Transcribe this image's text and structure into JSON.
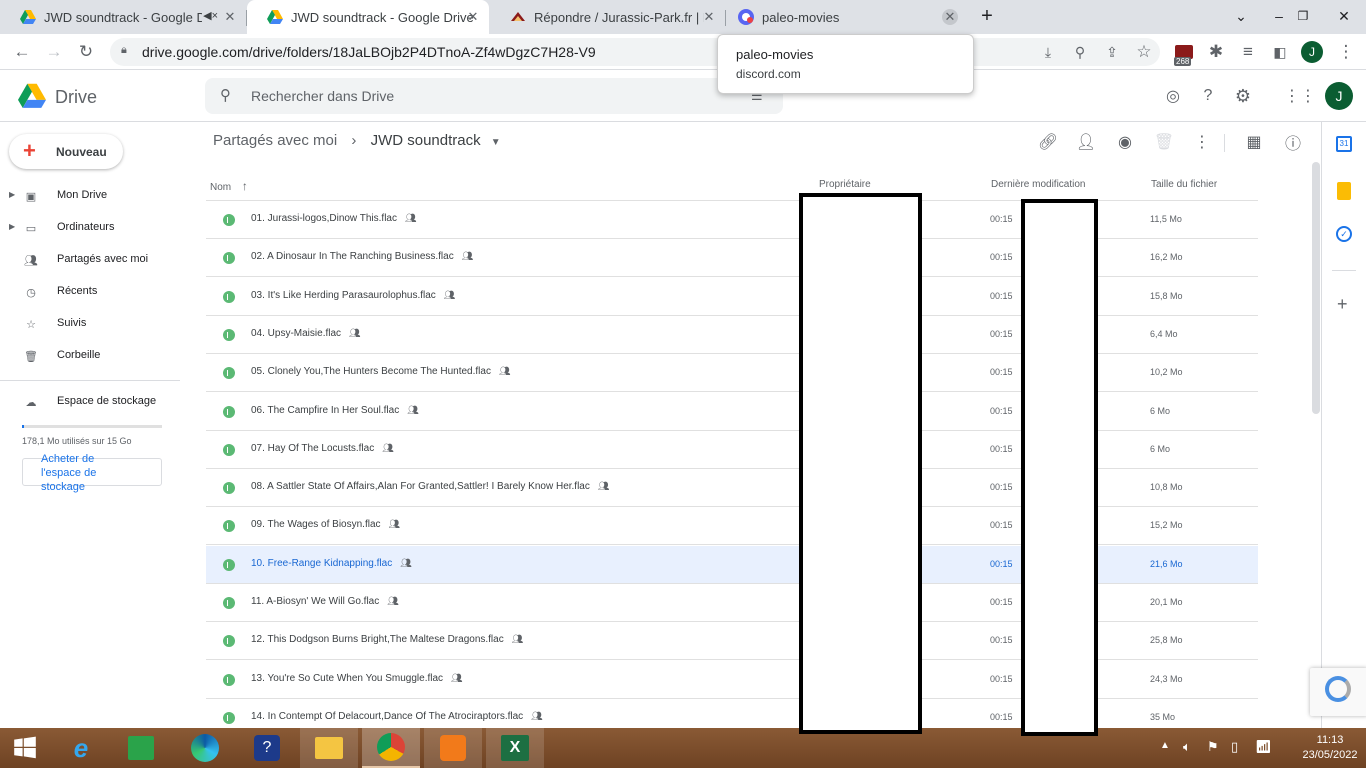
{
  "browser": {
    "tabs": [
      {
        "title": "JWD soundtrack - Google Drive",
        "active": false
      },
      {
        "title": "JWD soundtrack - Google Drive",
        "active": true
      },
      {
        "title": "Répondre / Jurassic-Park.fr | Le Forum",
        "active": false
      },
      {
        "title": "paleo-movies",
        "active": false
      }
    ],
    "url": "drive.google.com/drive/folders/18JaLBOjb2P4DTnoA-Zf4wDgzC7H28-V9",
    "badge": "268",
    "profile_letter": "J",
    "hover_card": {
      "title": "paleo-movies",
      "domain": "discord.com"
    }
  },
  "drive": {
    "app_name": "Drive",
    "search_placeholder": "Rechercher dans Drive",
    "avatar_letter": "J",
    "new_button": "Nouveau",
    "nav": [
      {
        "label": "Mon Drive",
        "icon": "my-drive-icon",
        "expandable": true
      },
      {
        "label": "Ordinateurs",
        "icon": "computer-icon",
        "expandable": true
      },
      {
        "label": "Partagés avec moi",
        "icon": "shared-icon",
        "expandable": false
      },
      {
        "label": "Récents",
        "icon": "clock-icon",
        "expandable": false
      },
      {
        "label": "Suivis",
        "icon": "star-icon",
        "expandable": false
      },
      {
        "label": "Corbeille",
        "icon": "trash-icon",
        "expandable": false
      }
    ],
    "storage": {
      "label": "Espace de stockage",
      "usage": "178,1 Mo utilisés sur 15 Go",
      "fraction_used": 0.012,
      "buy_button": "Acheter de l'espace de stockage"
    },
    "breadcrumb": {
      "parent": "Partagés avec moi",
      "current": "JWD soundtrack"
    },
    "columns": {
      "name": "Nom",
      "owner": "Propriétaire",
      "modified": "Dernière modification",
      "size": "Taille du fichier"
    },
    "files": [
      {
        "name": "01. Jurassi-logos,Dinow This.flac",
        "modified": "00:15",
        "size": "11,5 Mo"
      },
      {
        "name": "02. A Dinosaur In The Ranching Business.flac",
        "modified": "00:15",
        "size": "16,2 Mo"
      },
      {
        "name": "03. It's Like Herding Parasaurolophus.flac",
        "modified": "00:15",
        "size": "15,8 Mo"
      },
      {
        "name": "04. Upsy-Maisie.flac",
        "modified": "00:15",
        "size": "6,4 Mo"
      },
      {
        "name": "05. Clonely You,The Hunters Become The Hunted.flac",
        "modified": "00:15",
        "size": "10,2 Mo"
      },
      {
        "name": "06. The Campfire In Her Soul.flac",
        "modified": "00:15",
        "size": "6 Mo"
      },
      {
        "name": "07. Hay Of The Locusts.flac",
        "modified": "00:15",
        "size": "6 Mo"
      },
      {
        "name": "08. A Sattler State Of Affairs,Alan For Granted,Sattler! I Barely Know Her.flac",
        "modified": "00:15",
        "size": "10,8 Mo"
      },
      {
        "name": "09. The Wages of Biosyn.flac",
        "modified": "00:15",
        "size": "15,2 Mo"
      },
      {
        "name": "10. Free-Range Kidnapping.flac",
        "modified": "00:15",
        "size": "21,6 Mo",
        "selected": true
      },
      {
        "name": "11. A-Biosyn' We Will Go.flac",
        "modified": "00:15",
        "size": "20,1 Mo"
      },
      {
        "name": "12. This Dodgson Burns Bright,The Maltese Dragons.flac",
        "modified": "00:15",
        "size": "25,8 Mo"
      },
      {
        "name": "13. You're So Cute When You Smuggle.flac",
        "modified": "00:15",
        "size": "24,3 Mo"
      },
      {
        "name": "14. In Contempt Of Delacourt,Dance Of The Atrociraptors.flac",
        "modified": "00:15",
        "size": "35 Mo"
      }
    ]
  },
  "taskbar": {
    "time": "11:13",
    "date": "23/05/2022",
    "apps": [
      "start-icon",
      "ie-icon",
      "store-icon",
      "edge-icon",
      "help-icon",
      "explorer-icon",
      "chrome-icon",
      "vpn-icon",
      "excel-icon"
    ]
  },
  "colors": {
    "accent": "#1a73e8",
    "selected_row": "#e8f0fe",
    "taskbar": "#7a4b2a"
  }
}
